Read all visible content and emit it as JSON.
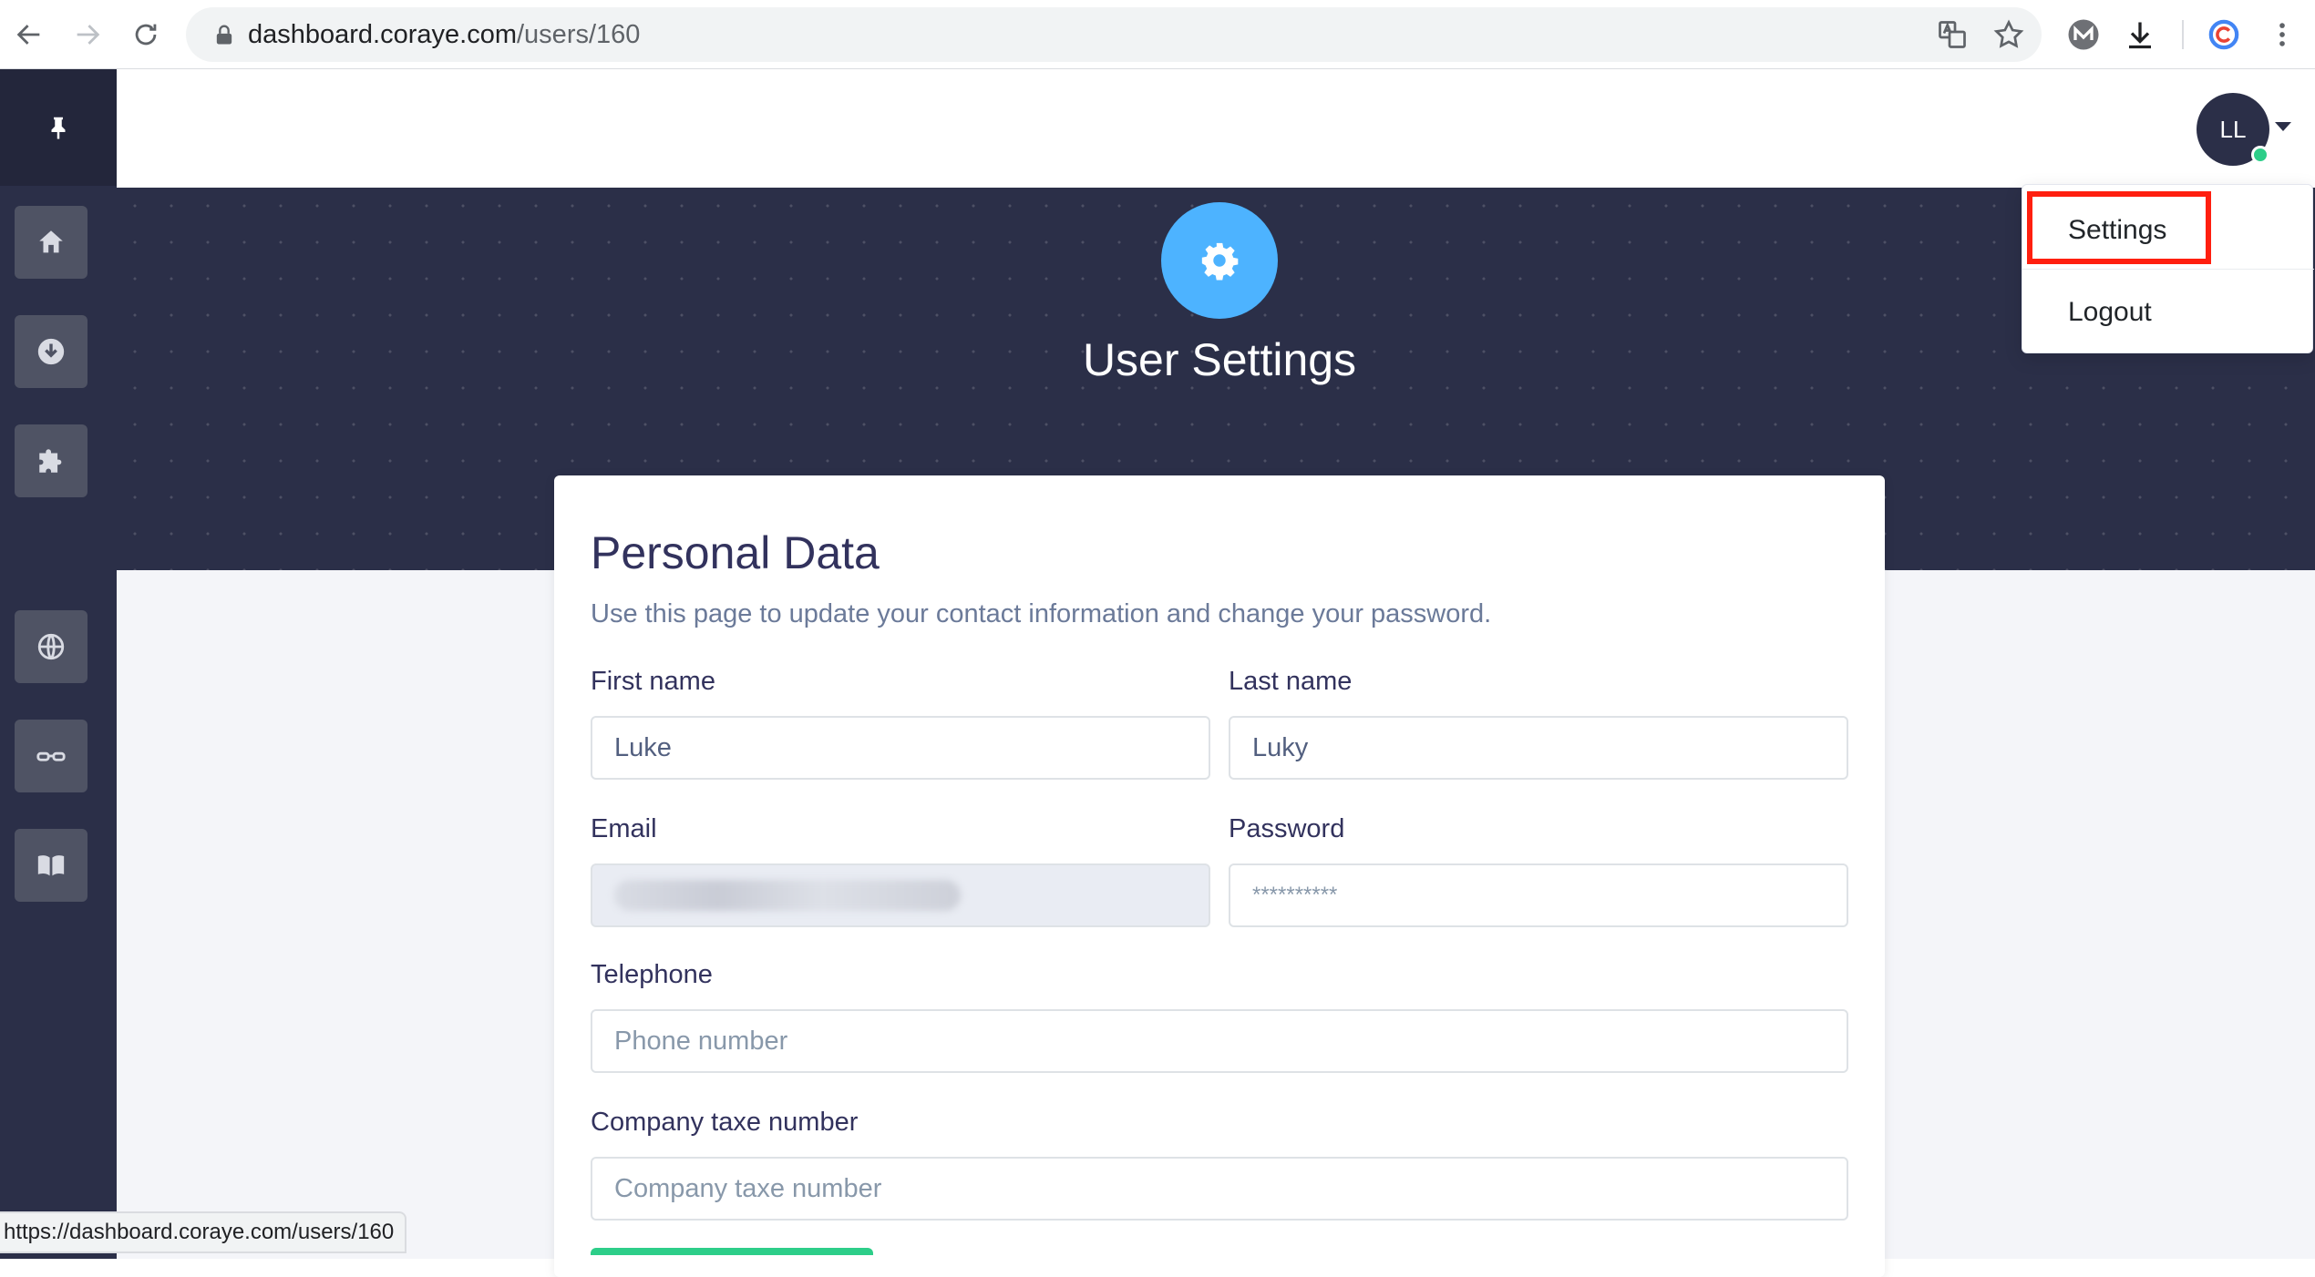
{
  "browser": {
    "url_host": "dashboard.coraye.com",
    "url_path": "/users/160",
    "status_url": "https://dashboard.coraye.com/users/160"
  },
  "sidebar": {
    "items": [
      {
        "icon": "home-icon"
      },
      {
        "icon": "download-icon"
      },
      {
        "icon": "puzzle-icon"
      },
      {
        "icon": "globe-icon"
      },
      {
        "icon": "glasses-icon"
      },
      {
        "icon": "book-icon"
      }
    ]
  },
  "header": {
    "avatar_initials": "LL"
  },
  "hero": {
    "title": "User Settings"
  },
  "user_menu": {
    "items": [
      "Settings",
      "Logout"
    ],
    "highlighted": "Settings"
  },
  "form": {
    "title": "Personal Data",
    "subtitle": "Use this page to update your contact information and change your password.",
    "first_name": {
      "label": "First name",
      "value": "Luke"
    },
    "last_name": {
      "label": "Last name",
      "value": "Luky"
    },
    "email": {
      "label": "Email"
    },
    "password": {
      "label": "Password",
      "value": "**********"
    },
    "telephone": {
      "label": "Telephone",
      "placeholder": "Phone number"
    },
    "company_tax": {
      "label": "Company taxe number",
      "placeholder": "Company taxe number"
    }
  },
  "colors": {
    "sidebar": "#2b2f48",
    "hero": "#2b2f48",
    "accent": "#4db3ff",
    "highlight_box": "#ff1f0f",
    "online_status": "#2dce89"
  }
}
